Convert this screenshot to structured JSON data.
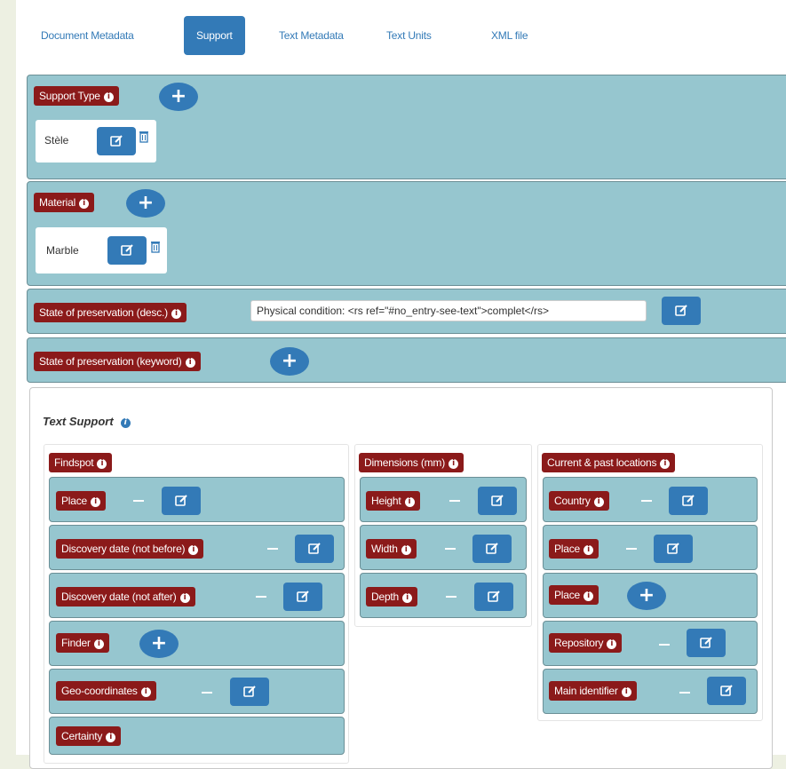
{
  "tabs": [
    {
      "label": "Document Metadata"
    },
    {
      "label": "Support"
    },
    {
      "label": "Text Metadata"
    },
    {
      "label": "Text Units"
    },
    {
      "label": "XML file"
    }
  ],
  "support_type": {
    "label": "Support Type",
    "value": "Stèle"
  },
  "material": {
    "label": "Material",
    "value": "Marble"
  },
  "preservation_desc": {
    "label": "State of preservation (desc.)",
    "value": "Physical condition: <rs ref=\"#no_entry-see-text\">complet</rs>"
  },
  "preservation_keyword": {
    "label": "State of preservation (keyword)"
  },
  "text_support": {
    "title": "Text Support",
    "findspot": {
      "label": "Findspot",
      "fields": [
        {
          "label": "Place"
        },
        {
          "label": "Discovery date (not before)"
        },
        {
          "label": "Discovery date (not after)"
        },
        {
          "label": "Finder"
        },
        {
          "label": "Geo-coordinates"
        },
        {
          "label": "Certainty"
        }
      ]
    },
    "dimensions": {
      "label": "Dimensions (mm)",
      "fields": [
        {
          "label": "Height"
        },
        {
          "label": "Width"
        },
        {
          "label": "Depth"
        }
      ]
    },
    "locations": {
      "label": "Current & past locations",
      "fields": [
        {
          "label": "Country"
        },
        {
          "label": "Place"
        },
        {
          "label": "Place"
        },
        {
          "label": "Repository"
        },
        {
          "label": "Main identifier"
        }
      ]
    }
  },
  "colors": {
    "badge": "#8b1a1a",
    "panel": "#96c6cf",
    "button": "#337ab7",
    "background": "#edf0e2"
  },
  "icons": {
    "add": "plus-icon",
    "edit": "edit-icon",
    "delete": "trash-icon",
    "info": "info-icon"
  }
}
